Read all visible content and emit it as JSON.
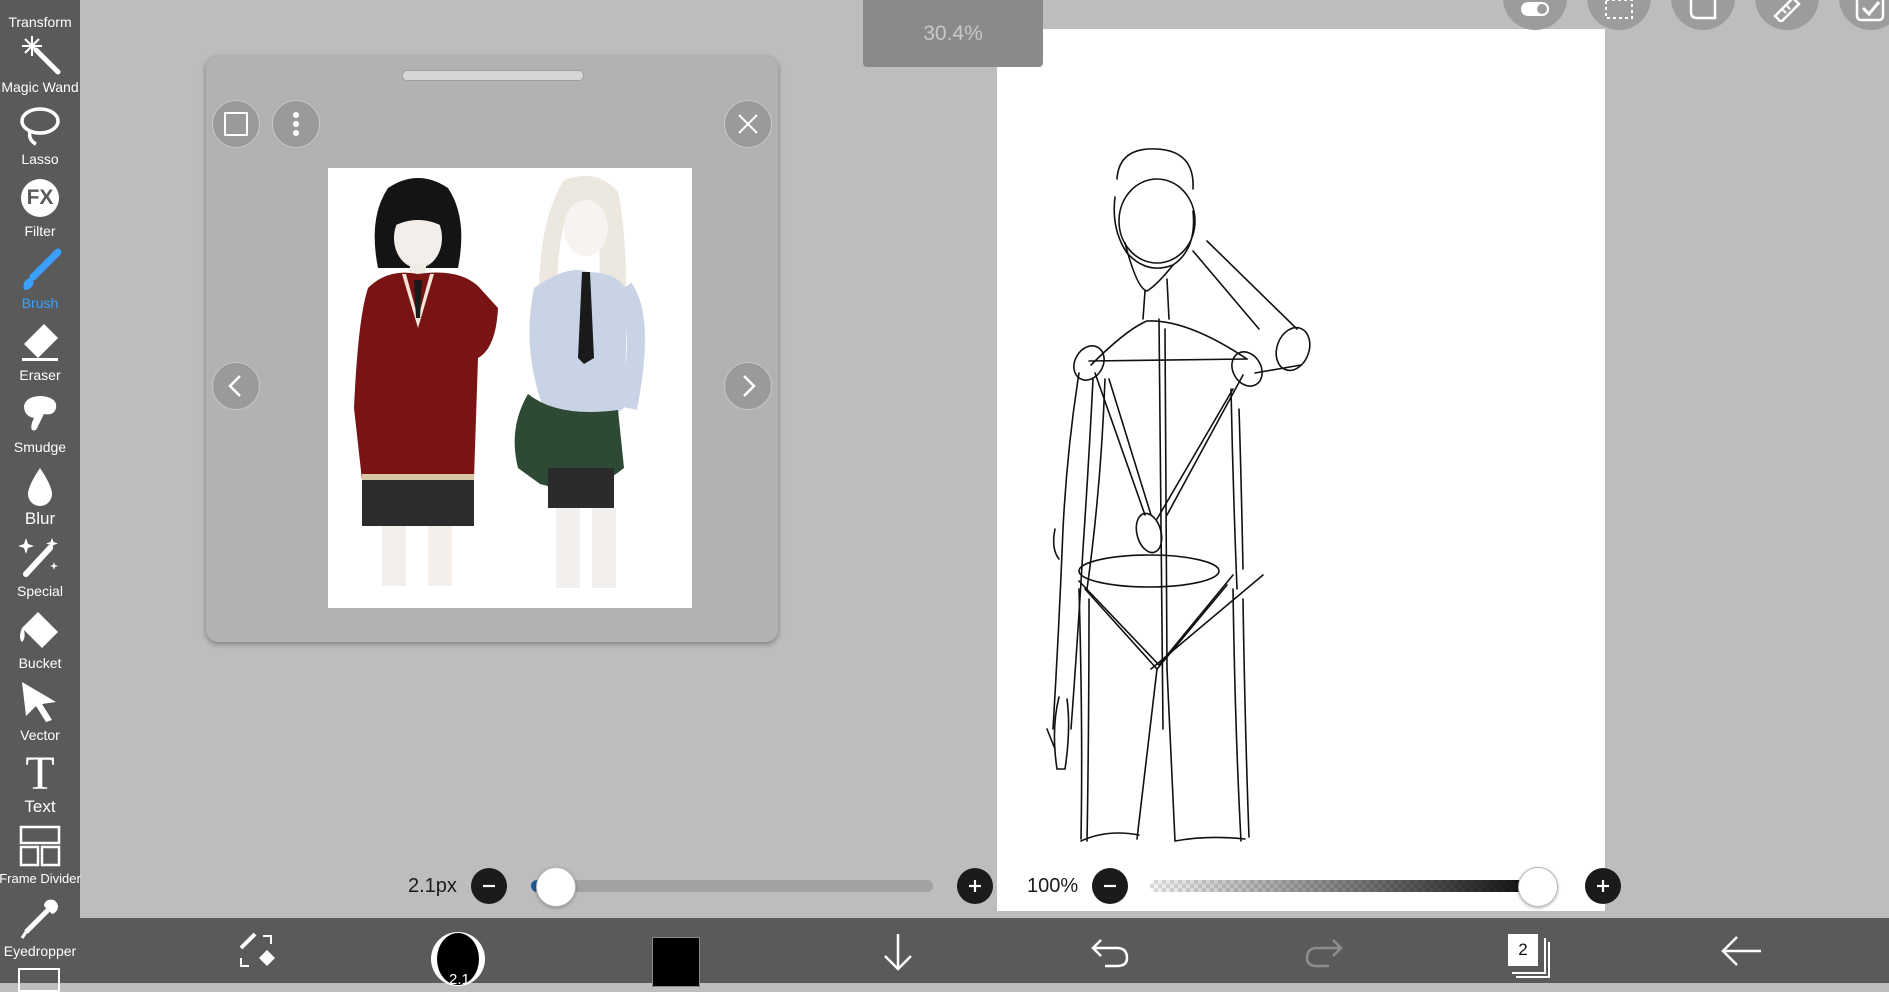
{
  "toolbar": {
    "tools": [
      {
        "label": "Transform",
        "icon": "transform-icon"
      },
      {
        "label": "Magic Wand",
        "icon": "magic-wand-icon"
      },
      {
        "label": "Lasso",
        "icon": "lasso-icon"
      },
      {
        "label": "Filter",
        "icon": "filter-fx-icon",
        "glyph": "FX"
      },
      {
        "label": "Brush",
        "icon": "brush-icon",
        "active": true
      },
      {
        "label": "Eraser",
        "icon": "eraser-icon"
      },
      {
        "label": "Smudge",
        "icon": "smudge-icon"
      },
      {
        "label": "Blur",
        "icon": "blur-drop-icon"
      },
      {
        "label": "Special",
        "icon": "special-icon"
      },
      {
        "label": "Bucket",
        "icon": "bucket-icon"
      },
      {
        "label": "Vector",
        "icon": "vector-cursor-icon"
      },
      {
        "label": "Text",
        "icon": "text-icon",
        "glyph": "T"
      },
      {
        "label": "Frame Divider",
        "icon": "frame-divider-icon"
      },
      {
        "label": "Eyedropper",
        "icon": "eyedropper-icon"
      }
    ],
    "active_color": "#3aa0ff"
  },
  "zoom": {
    "value": "30.4%"
  },
  "top_buttons": [
    "toggle-icon",
    "selection-icon",
    "layer-shape-icon",
    "ruler-icon",
    "check-icon"
  ],
  "reference_panel": {
    "buttons": [
      "square-icon",
      "more-vertical-icon",
      "close-icon",
      "chevron-left-icon",
      "chevron-right-icon"
    ]
  },
  "brush_size": {
    "label": "2.1px",
    "value_fraction": 0.06,
    "fill_color": "#1e5a9a"
  },
  "opacity": {
    "label": "100%",
    "value_fraction": 1.0
  },
  "bottom_bar": {
    "items": [
      {
        "name": "brush-eraser-swap-icon"
      },
      {
        "name": "brush-preview-icon",
        "text": "2.1"
      },
      {
        "name": "color-swatch",
        "color": "#000000"
      },
      {
        "name": "download-arrow-icon"
      },
      {
        "name": "undo-icon"
      },
      {
        "name": "redo-icon"
      },
      {
        "name": "layers-icon",
        "text": "2"
      },
      {
        "name": "back-arrow-icon"
      }
    ]
  },
  "colors": {
    "background": "#bdbdbd",
    "toolbar": "#5a5a5a",
    "canvas": "#ffffff",
    "active": "#3aa0ff"
  }
}
